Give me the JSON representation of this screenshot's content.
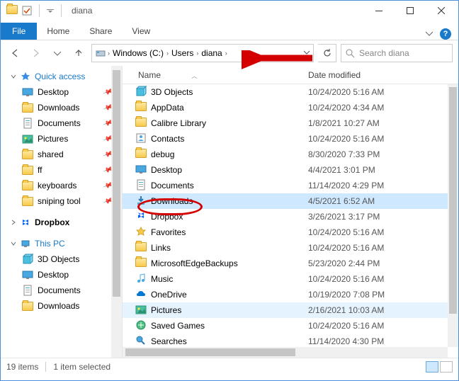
{
  "window": {
    "title": "diana"
  },
  "ribbon": {
    "file": "File",
    "tabs": [
      "Home",
      "Share",
      "View"
    ]
  },
  "breadcrumb": {
    "parts": [
      "Windows (C:)",
      "Users",
      "diana"
    ]
  },
  "search": {
    "placeholder": "Search diana"
  },
  "sidebar": {
    "quick": {
      "label": "Quick access"
    },
    "quick_items": [
      {
        "label": "Desktop",
        "pin": true,
        "icon": "desktop"
      },
      {
        "label": "Downloads",
        "pin": true,
        "icon": "folder"
      },
      {
        "label": "Documents",
        "pin": true,
        "icon": "doc"
      },
      {
        "label": "Pictures",
        "pin": true,
        "icon": "pic"
      },
      {
        "label": "shared",
        "pin": true,
        "icon": "folder"
      },
      {
        "label": "ff",
        "pin": true,
        "icon": "folder"
      },
      {
        "label": "keyboards",
        "pin": true,
        "icon": "folder"
      },
      {
        "label": "sniping tool",
        "pin": true,
        "icon": "folder"
      }
    ],
    "dropbox": {
      "label": "Dropbox"
    },
    "thispc": {
      "label": "This PC"
    },
    "pc_items": [
      {
        "label": "3D Objects",
        "icon": "3d"
      },
      {
        "label": "Desktop",
        "icon": "desktop"
      },
      {
        "label": "Documents",
        "icon": "doc"
      },
      {
        "label": "Downloads",
        "icon": "folder"
      }
    ]
  },
  "columns": {
    "name": "Name",
    "date": "Date modified"
  },
  "files": [
    {
      "name": "3D Objects",
      "date": "10/24/2020 5:16 AM",
      "icon": "3d"
    },
    {
      "name": "AppData",
      "date": "10/24/2020 4:34 AM",
      "icon": "folder"
    },
    {
      "name": "Calibre Library",
      "date": "1/8/2021 10:27 AM",
      "icon": "folder"
    },
    {
      "name": "Contacts",
      "date": "10/24/2020 5:16 AM",
      "icon": "contacts"
    },
    {
      "name": "debug",
      "date": "8/30/2020 7:33 PM",
      "icon": "folder"
    },
    {
      "name": "Desktop",
      "date": "4/4/2021 3:01 PM",
      "icon": "desktop"
    },
    {
      "name": "Documents",
      "date": "11/14/2020 4:29 PM",
      "icon": "doc"
    },
    {
      "name": "Downloads",
      "date": "4/5/2021 6:52 AM",
      "icon": "downloads",
      "sel": true
    },
    {
      "name": "Dropbox",
      "date": "3/26/2021 3:17 PM",
      "icon": "dropbox"
    },
    {
      "name": "Favorites",
      "date": "10/24/2020 5:16 AM",
      "icon": "fav"
    },
    {
      "name": "Links",
      "date": "10/24/2020 5:16 AM",
      "icon": "folder"
    },
    {
      "name": "MicrosoftEdgeBackups",
      "date": "5/23/2020 2:44 PM",
      "icon": "folder"
    },
    {
      "name": "Music",
      "date": "10/24/2020 5:16 AM",
      "icon": "music"
    },
    {
      "name": "OneDrive",
      "date": "10/19/2020 7:08 PM",
      "icon": "onedrive"
    },
    {
      "name": "Pictures",
      "date": "2/16/2021 10:03 AM",
      "icon": "pic",
      "hov": true
    },
    {
      "name": "Saved Games",
      "date": "10/24/2020 5:16 AM",
      "icon": "games"
    },
    {
      "name": "Searches",
      "date": "11/14/2020 4:30 PM",
      "icon": "search"
    }
  ],
  "status": {
    "count": "19 items",
    "selected": "1 item selected"
  }
}
